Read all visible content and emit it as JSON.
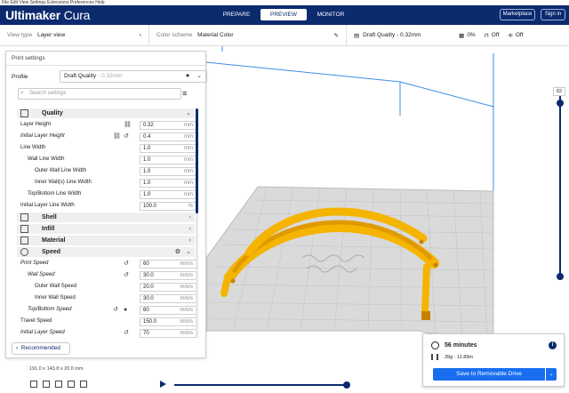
{
  "menubar": {
    "text": "File  Edit  View  Settings  Extensions  Preferences  Help"
  },
  "header": {
    "logo_bold": "Ultimaker",
    "logo_light": " Cura",
    "tabs": [
      "PREPARE",
      "PREVIEW",
      "MONITOR"
    ],
    "active_tab": "PREVIEW",
    "marketplace": "Marketplace",
    "signin": "Sign in"
  },
  "topbar": {
    "view_type_label": "View type",
    "view_type_value": "Layer view",
    "color_scheme_label": "Color scheme",
    "color_scheme_value": "Material Color",
    "profile": "Draft Quality - 0.32mm",
    "infill": "0%",
    "support": "Off",
    "adhesion": "Off"
  },
  "panel": {
    "title": "Print settings",
    "profile_label": "Profile",
    "profile_value": "Draft Quality",
    "profile_sub": "- 0.32mm",
    "search_placeholder": "Search settings",
    "categories": {
      "quality": "Quality",
      "shell": "Shell",
      "infill": "Infill",
      "material": "Material",
      "speed": "Speed"
    },
    "rows": [
      {
        "label": "Layer Height",
        "value": "0.32",
        "unit": "mm"
      },
      {
        "label": "Initial Layer Height",
        "value": "0.4",
        "unit": "mm"
      },
      {
        "label": "Line Width",
        "value": "1.0",
        "unit": "mm"
      },
      {
        "label": "Wall Line Width",
        "value": "1.0",
        "unit": "mm"
      },
      {
        "label": "Outer Wall Line Width",
        "value": "1.0",
        "unit": "mm"
      },
      {
        "label": "Inner Wall(s) Line Width",
        "value": "1.0",
        "unit": "mm"
      },
      {
        "label": "Top/Bottom Line Width",
        "value": "1.0",
        "unit": "mm"
      },
      {
        "label": "Initial Layer Line Width",
        "value": "100.0",
        "unit": "%"
      },
      {
        "label": "Print Speed",
        "value": "60",
        "unit": "mm/s"
      },
      {
        "label": "Wall Speed",
        "value": "30.0",
        "unit": "mm/s"
      },
      {
        "label": "Outer Wall Speed",
        "value": "20.0",
        "unit": "mm/s"
      },
      {
        "label": "Inner Wall Speed",
        "value": "30.0",
        "unit": "mm/s"
      },
      {
        "label": "Top/Bottom Speed",
        "value": "60",
        "unit": "mm/s"
      },
      {
        "label": "Travel Speed",
        "value": "150.0",
        "unit": "mm/s"
      },
      {
        "label": "Initial Layer Speed",
        "value": "70",
        "unit": "mm/s"
      }
    ],
    "recommended": "Recommended"
  },
  "dimensions": "191.0 x 143.8 x 20.0 mm",
  "layer_slider": {
    "current_layer": "62"
  },
  "job": {
    "time": "56 minutes",
    "material": "39g · 11.89m",
    "save_button": "Save to Removable Drive"
  },
  "colors": {
    "header": "#0c2a6e",
    "accent": "#196ef0",
    "print": "#f5b400"
  }
}
